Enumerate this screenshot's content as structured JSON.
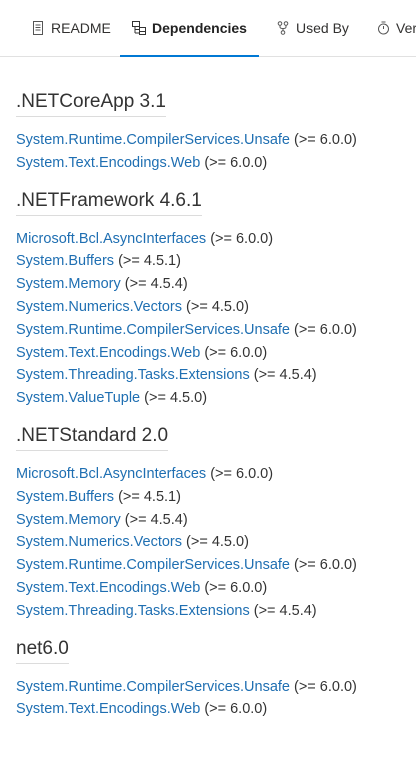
{
  "tabs": {
    "readme": "README",
    "dependencies": "Dependencies",
    "used_by": "Used By",
    "versions": "Versions"
  },
  "colors": {
    "link": "#1f6fb2",
    "accent": "#0078d4"
  },
  "groups": [
    {
      "title": ".NETCoreApp 3.1",
      "deps": [
        {
          "name": "System.Runtime.CompilerServices.Unsafe",
          "version": "(>= 6.0.0)"
        },
        {
          "name": "System.Text.Encodings.Web",
          "version": "(>= 6.0.0)"
        }
      ]
    },
    {
      "title": ".NETFramework 4.6.1",
      "deps": [
        {
          "name": "Microsoft.Bcl.AsyncInterfaces",
          "version": "(>= 6.0.0)"
        },
        {
          "name": "System.Buffers",
          "version": "(>= 4.5.1)"
        },
        {
          "name": "System.Memory",
          "version": "(>= 4.5.4)"
        },
        {
          "name": "System.Numerics.Vectors",
          "version": "(>= 4.5.0)"
        },
        {
          "name": "System.Runtime.CompilerServices.Unsafe",
          "version": "(>= 6.0.0)"
        },
        {
          "name": "System.Text.Encodings.Web",
          "version": "(>= 6.0.0)"
        },
        {
          "name": "System.Threading.Tasks.Extensions",
          "version": "(>= 4.5.4)"
        },
        {
          "name": "System.ValueTuple",
          "version": "(>= 4.5.0)"
        }
      ]
    },
    {
      "title": ".NETStandard 2.0",
      "deps": [
        {
          "name": "Microsoft.Bcl.AsyncInterfaces",
          "version": "(>= 6.0.0)"
        },
        {
          "name": "System.Buffers",
          "version": "(>= 4.5.1)"
        },
        {
          "name": "System.Memory",
          "version": "(>= 4.5.4)"
        },
        {
          "name": "System.Numerics.Vectors",
          "version": "(>= 4.5.0)"
        },
        {
          "name": "System.Runtime.CompilerServices.Unsafe",
          "version": "(>= 6.0.0)"
        },
        {
          "name": "System.Text.Encodings.Web",
          "version": "(>= 6.0.0)"
        },
        {
          "name": "System.Threading.Tasks.Extensions",
          "version": "(>= 4.5.4)"
        }
      ]
    },
    {
      "title": "net6.0",
      "deps": [
        {
          "name": "System.Runtime.CompilerServices.Unsafe",
          "version": "(>= 6.0.0)"
        },
        {
          "name": "System.Text.Encodings.Web",
          "version": "(>= 6.0.0)"
        }
      ]
    }
  ]
}
